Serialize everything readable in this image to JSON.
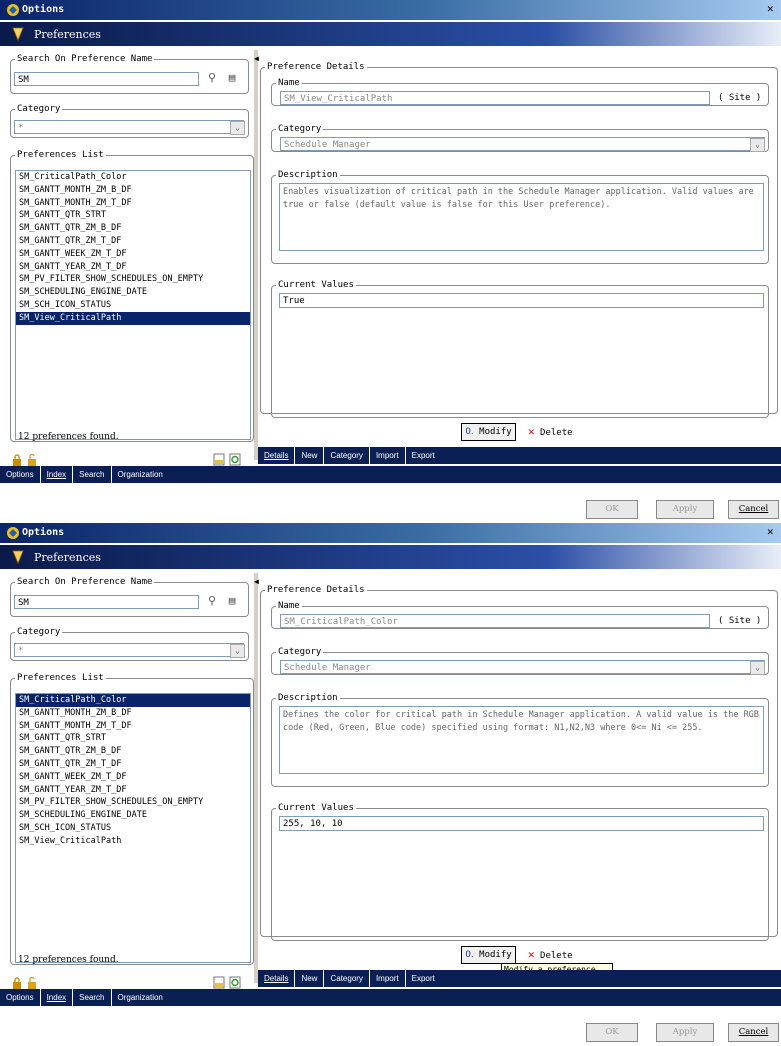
{
  "windows": [
    {
      "title": "Options",
      "header": "Preferences",
      "search": {
        "legend": "Search On Preference Name",
        "value": "SM"
      },
      "category_filter": {
        "legend": "Category",
        "value": "*"
      },
      "list": {
        "legend": "Preferences List",
        "items": [
          "SM_CriticalPath_Color",
          "SM_GANTT_MONTH_ZM_B_DF",
          "SM_GANTT_MONTH_ZM_T_DF",
          "SM_GANTT_QTR_STRT",
          "SM_GANTT_QTR_ZM_B_DF",
          "SM_GANTT_QTR_ZM_T_DF",
          "SM_GANTT_WEEK_ZM_T_DF",
          "SM_GANTT_YEAR_ZM_T_DF",
          "SM_PV_FILTER_SHOW_SCHEDULES_ON_EMPTY",
          "SM_SCHEDULING_ENGINE_DATE",
          "SM_SCH_ICON_STATUS",
          "SM_View_CriticalPath"
        ],
        "selected_index": 11,
        "found_text": "12 preferences found."
      },
      "details": {
        "legend": "Preference Details",
        "name_legend": "Name",
        "name_value": "SM_View_CriticalPath",
        "scope": "( Site )",
        "category_legend": "Category",
        "category_value": "Schedule Manager",
        "description_legend": "Description",
        "description": "Enables visualization of critical path in the Schedule Manager application. Valid values are true or false (default value is false for this User preference).",
        "current_legend": "Current Values",
        "current_value": "True"
      },
      "modify_label": "Modify",
      "delete_label": "Delete",
      "tooltip": "",
      "right_tabs": [
        "Details",
        "New",
        "Category",
        "Import",
        "Export"
      ],
      "left_tabs": [
        "Options",
        "Index",
        "Search",
        "Organization"
      ],
      "buttons": {
        "ok": "OK",
        "apply": "Apply",
        "cancel": "Cancel"
      }
    },
    {
      "title": "Options",
      "header": "Preferences",
      "search": {
        "legend": "Search On Preference Name",
        "value": "SM"
      },
      "category_filter": {
        "legend": "Category",
        "value": "*"
      },
      "list": {
        "legend": "Preferences List",
        "items": [
          "SM_CriticalPath_Color",
          "SM_GANTT_MONTH_ZM_B_DF",
          "SM_GANTT_MONTH_ZM_T_DF",
          "SM_GANTT_QTR_STRT",
          "SM_GANTT_QTR_ZM_B_DF",
          "SM_GANTT_QTR_ZM_T_DF",
          "SM_GANTT_WEEK_ZM_T_DF",
          "SM_GANTT_YEAR_ZM_T_DF",
          "SM_PV_FILTER_SHOW_SCHEDULES_ON_EMPTY",
          "SM_SCHEDULING_ENGINE_DATE",
          "SM_SCH_ICON_STATUS",
          "SM_View_CriticalPath"
        ],
        "selected_index": 0,
        "found_text": "12 preferences found."
      },
      "details": {
        "legend": "Preference Details",
        "name_legend": "Name",
        "name_value": "SM_CriticalPath_Color",
        "scope": "( Site )",
        "category_legend": "Category",
        "category_value": "Schedule Manager",
        "description_legend": "Description",
        "description": "Defines the color for critical path in Schedule Manager application. A valid value is the RGB code (Red, Green, Blue code) specified using format: N1,N2,N3 where 0<= Ni <= 255.",
        "current_legend": "Current Values",
        "current_value": "255, 10, 10"
      },
      "modify_label": "Modify",
      "delete_label": "Delete",
      "tooltip": "Modify a preference",
      "right_tabs": [
        "Details",
        "New",
        "Category",
        "Import",
        "Export"
      ],
      "left_tabs": [
        "Options",
        "Index",
        "Search",
        "Organization"
      ],
      "buttons": {
        "ok": "OK",
        "apply": "Apply",
        "cancel": "Cancel"
      }
    }
  ]
}
